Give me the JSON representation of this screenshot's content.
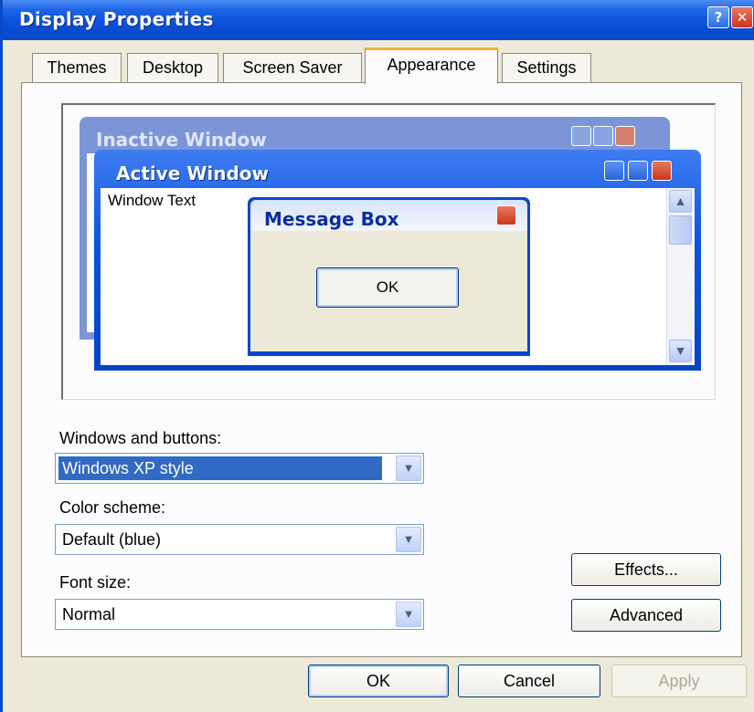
{
  "window": {
    "title": "Display Properties",
    "help_glyph": "?",
    "close_glyph": "✕"
  },
  "tabs": [
    {
      "label": "Themes"
    },
    {
      "label": "Desktop"
    },
    {
      "label": "Screen Saver"
    },
    {
      "label": "Appearance"
    },
    {
      "label": "Settings"
    }
  ],
  "active_tab": "Appearance",
  "preview": {
    "inactive_title": "Inactive Window",
    "active_title": "Active Window",
    "window_text": "Window Text",
    "message_title": "Message Box",
    "message_ok": "OK"
  },
  "appearance": {
    "windows_buttons_label": "Windows and buttons:",
    "windows_buttons_value": "Windows XP style",
    "color_scheme_label": "Color scheme:",
    "color_scheme_value": "Default (blue)",
    "font_size_label": "Font size:",
    "font_size_value": "Normal",
    "effects_label": "Effects...",
    "advanced_label": "Advanced"
  },
  "footer": {
    "ok": "OK",
    "cancel": "Cancel",
    "apply": "Apply"
  },
  "colors": {
    "titlebar": "#0a50d8",
    "dialog_bg": "#ece9d8",
    "active_tab_accent": "#f5b13a",
    "selection": "#316ac5"
  }
}
